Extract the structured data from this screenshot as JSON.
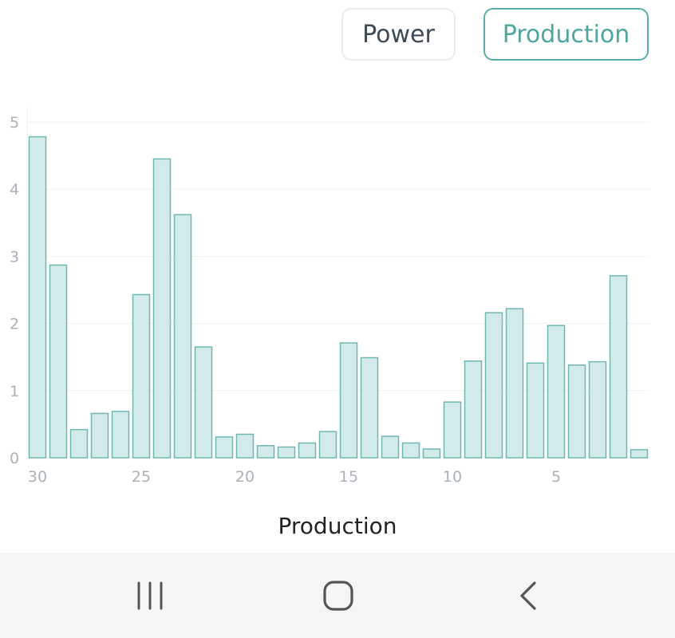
{
  "toggles": {
    "power_label": "Power",
    "production_label": "Production",
    "active": "production"
  },
  "chart_data": {
    "type": "bar",
    "title": "",
    "xlabel": "Production",
    "ylabel": "",
    "ylim": [
      0,
      5
    ],
    "yticks": [
      0,
      1,
      2,
      3,
      4,
      5
    ],
    "x_tick_labels": [
      "30",
      "25",
      "20",
      "15",
      "10",
      "5"
    ],
    "categories": [
      "30",
      "29",
      "28",
      "27",
      "26",
      "25",
      "24",
      "23",
      "22",
      "21",
      "20",
      "19",
      "18",
      "17",
      "16",
      "15",
      "14",
      "13",
      "12",
      "11",
      "10",
      "9",
      "8",
      "7",
      "6",
      "5",
      "4",
      "3",
      "2",
      "1"
    ],
    "values": [
      4.78,
      2.87,
      0.42,
      0.66,
      0.69,
      2.43,
      4.45,
      3.62,
      1.65,
      0.31,
      0.35,
      0.18,
      0.16,
      0.22,
      0.39,
      1.71,
      1.49,
      0.32,
      0.22,
      0.13,
      0.83,
      1.44,
      2.16,
      2.22,
      1.41,
      1.97,
      1.38,
      1.43,
      2.71,
      0.12
    ],
    "grid": true,
    "bar_fill": "#d3eaea",
    "bar_stroke": "#6fb8b2"
  },
  "navbar": {
    "recents_icon": "recents-icon",
    "home_icon": "home-icon",
    "back_icon": "back-icon"
  }
}
